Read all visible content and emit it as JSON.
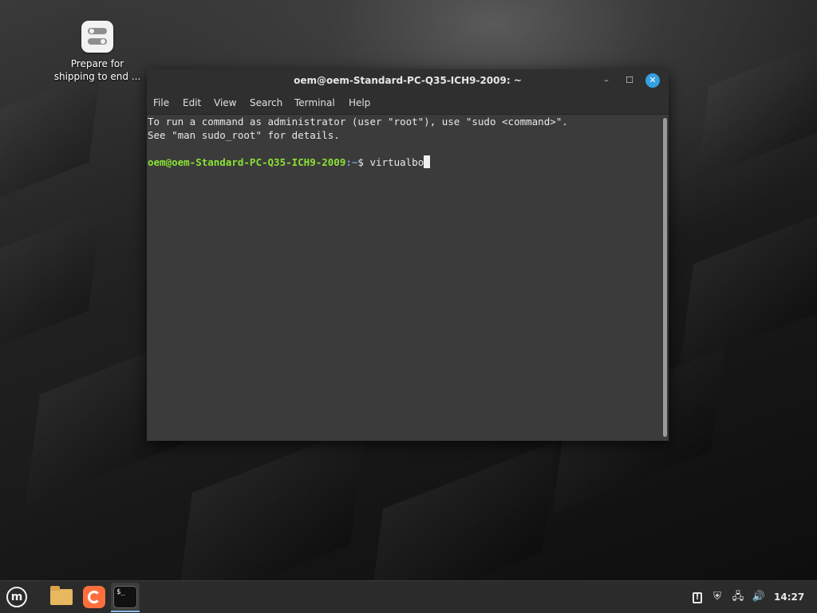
{
  "desktop": {
    "icon_label": "Prepare for shipping to end ...",
    "icon_label_line1": "Prepare for",
    "icon_label_line2": "shipping to end ..."
  },
  "window": {
    "title": "oem@oem-Standard-PC-Q35-ICH9-2009: ~",
    "minimize_glyph": "–",
    "maximize_glyph": "☐",
    "close_glyph": "✕",
    "close_color": "#35a0e0"
  },
  "menubar": {
    "items": [
      "File",
      "Edit",
      "View",
      "Search",
      "Terminal",
      "Help"
    ]
  },
  "terminal": {
    "line1": "To run a command as administrator (user \"root\"), use \"sudo <command>\".",
    "line2": "See \"man sudo_root\" for details.",
    "prompt_user": "oem@oem-Standard-PC-Q35-ICH9-2009",
    "prompt_path": ":~",
    "prompt_symbol": "$ ",
    "typed_command": "virtualbo",
    "colors": {
      "prompt_user": "#8ae234",
      "prompt_path": "#729fcf",
      "background": "#3b3b3b"
    }
  },
  "taskbar": {
    "menu_icon": "linux-mint-logo-icon",
    "menu_glyph": "m",
    "launchers": [
      "files-folder-icon",
      "firefox-icon",
      "terminal-icon"
    ],
    "terminal_glyph": "$_",
    "tray": {
      "update_icon": "update-manager-icon",
      "update_glyph": "!",
      "shield_icon": "shield-icon",
      "shield_glyph": "⛨",
      "network_icon": "network-icon",
      "network_glyph": "🖧",
      "volume_icon": "volume-icon",
      "volume_glyph": "🔊",
      "clock": "14:27"
    }
  }
}
